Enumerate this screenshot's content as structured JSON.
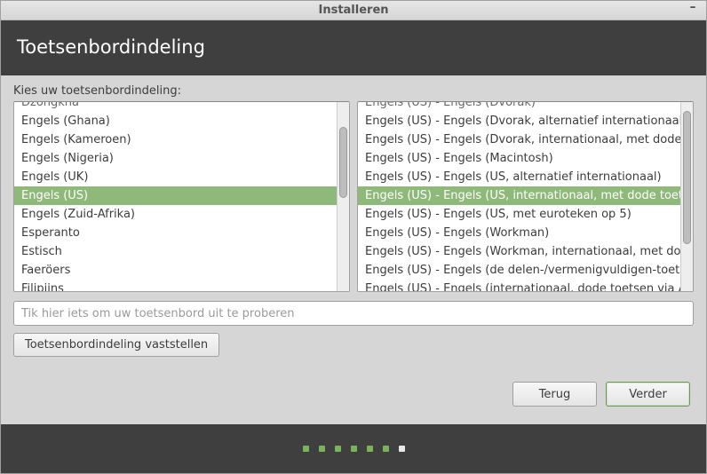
{
  "window": {
    "title": "Installeren"
  },
  "header": {
    "title": "Toetsenbordindeling"
  },
  "chooseLabel": "Kies uw toetsenbordindeling:",
  "leftList": {
    "selectedIndex": 5,
    "items": [
      "Dzongkha",
      "Engels (Ghana)",
      "Engels (Kameroen)",
      "Engels (Nigeria)",
      "Engels (UK)",
      "Engels (US)",
      "Engels (Zuid-Afrika)",
      "Esperanto",
      "Estisch",
      "Faeröers",
      "Filipijns"
    ]
  },
  "rightList": {
    "selectedIndex": 5,
    "items": [
      "Engels (US) - Engels (Dvorak)",
      "Engels (US) - Engels (Dvorak, alternatief internationaal, geen dode toetsen)",
      "Engels (US) - Engels (Dvorak, internationaal, met dode toetsen)",
      "Engels (US) - Engels (Macintosh)",
      "Engels (US) - Engels (US, alternatief internationaal)",
      "Engels (US) - Engels (US, internationaal, met dode toetsen)",
      "Engels (US) - Engels (US, met euroteken op 5)",
      "Engels (US) - Engels (Workman)",
      "Engels (US) - Engels (Workman, internationaal, met dode toetsen)",
      "Engels (US) - Engels (de delen-/vermenigvuldigen-toetsen schakelen layout)",
      "Engels (US) - Engels (internationaal, dode toetsen via AltGr)"
    ]
  },
  "tryInputPlaceholder": "Tik hier iets om uw toetsenbord uit te proberen",
  "detectButton": "Toetsenbordindeling vaststellen",
  "nav": {
    "back": "Terug",
    "forward": "Verder"
  },
  "progress": {
    "total": 7,
    "current": 7
  }
}
